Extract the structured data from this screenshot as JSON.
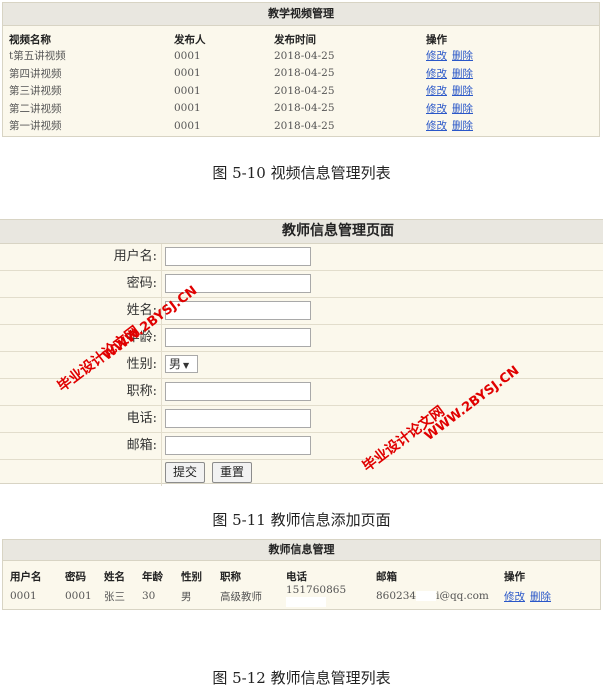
{
  "video_panel": {
    "title": "教学视频管理",
    "headers": [
      "视频名称",
      "发布人",
      "发布时间",
      "操作"
    ],
    "rows": [
      {
        "name": "t第五讲视频",
        "publisher": "0001",
        "date": "2018-04-25"
      },
      {
        "name": "第四讲视频",
        "publisher": "0001",
        "date": "2018-04-25"
      },
      {
        "name": "第三讲视频",
        "publisher": "0001",
        "date": "2018-04-25"
      },
      {
        "name": "第二讲视频",
        "publisher": "0001",
        "date": "2018-04-25"
      },
      {
        "name": "第一讲视频",
        "publisher": "0001",
        "date": "2018-04-25"
      }
    ],
    "edit_label": "修改",
    "delete_label": "删除"
  },
  "caption1": "图 5-10 视频信息管理列表",
  "form_panel": {
    "title": "教师信息管理页面",
    "labels": {
      "username": "用户名:",
      "password": "密码:",
      "name": "姓名:",
      "age": "年龄:",
      "gender": "性别:",
      "title": "职称:",
      "phone": "电话:",
      "email": "邮箱:"
    },
    "gender_value": "男",
    "submit_label": "提交",
    "reset_label": "重置"
  },
  "caption2": "图 5-11 教师信息添加页面",
  "watermark": {
    "line1": "毕业设计论文网",
    "line2": "WWW.2BYSJ.CN",
    "color": "#e00000"
  },
  "teacher_panel": {
    "title": "教师信息管理",
    "headers": [
      "用户名",
      "密码",
      "姓名",
      "年龄",
      "性别",
      "职称",
      "电话",
      "邮箱",
      "操作"
    ],
    "row": {
      "username": "0001",
      "password": "0001",
      "name": "张三",
      "age": "30",
      "gender": "男",
      "title": "高级教师",
      "phone": "151760865",
      "email_start": "860234",
      "email_end": "i@qq.com"
    },
    "edit_label": "修改",
    "delete_label": "删除"
  },
  "caption3": "图 5-12 教师信息管理列表"
}
